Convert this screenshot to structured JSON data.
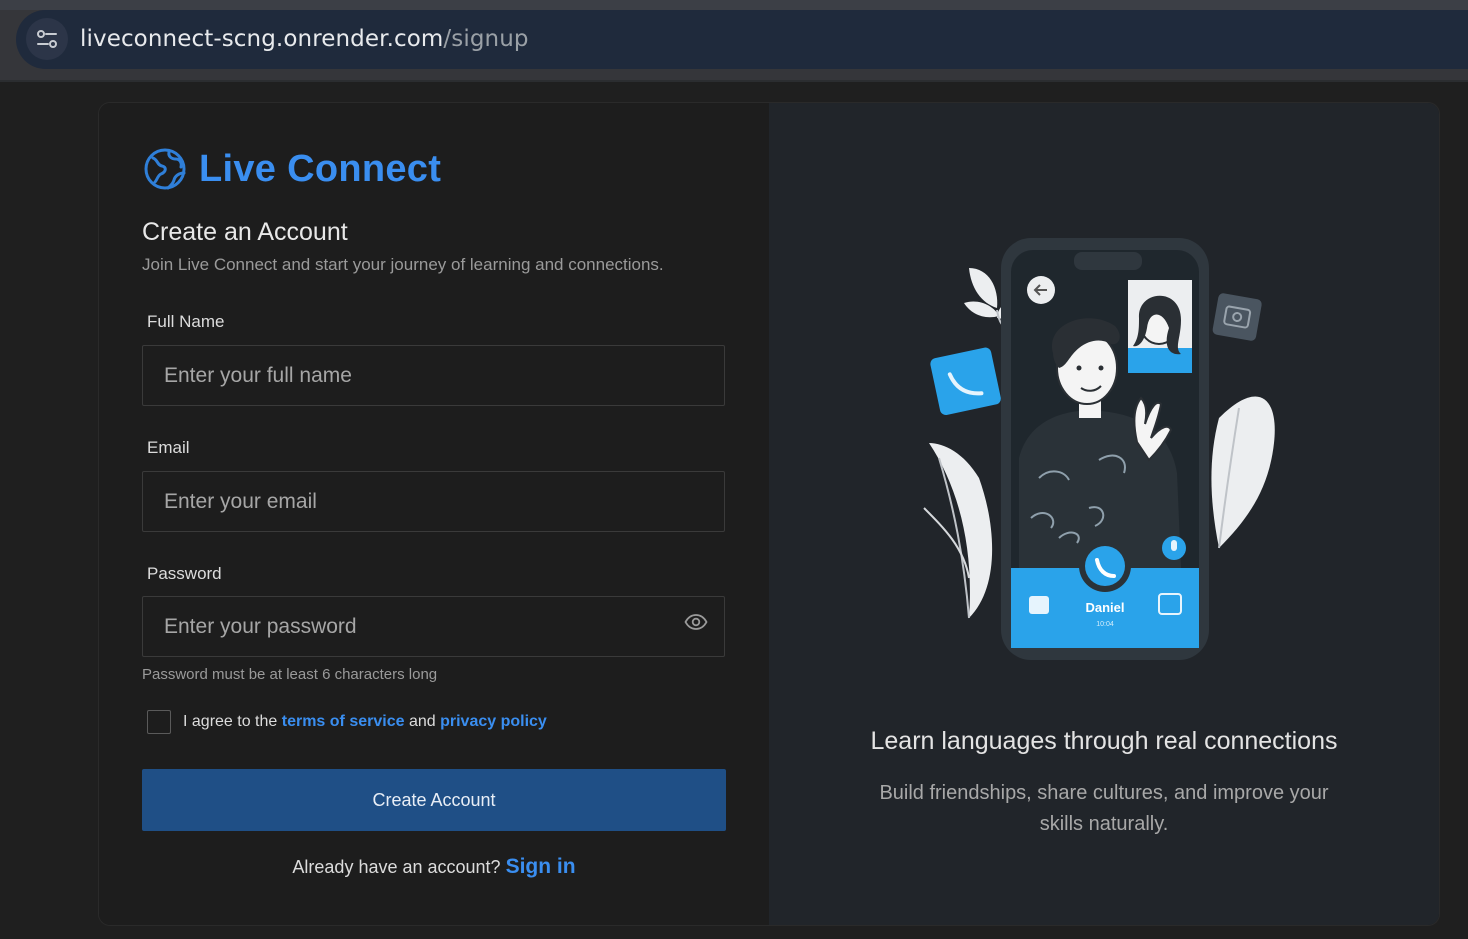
{
  "browser": {
    "url_host": "liveconnect-scng.onrender.com",
    "url_path": "/signup",
    "site_settings_icon": "tune-icon"
  },
  "brand": {
    "name": "Live Connect",
    "logo_icon": "globe-icon",
    "color": "#3a8ef0"
  },
  "form": {
    "title": "Create an Account",
    "subtitle": "Join Live Connect and start your journey of learning and connections.",
    "full_name": {
      "label": "Full Name",
      "placeholder": "Enter your full name",
      "value": ""
    },
    "email": {
      "label": "Email",
      "placeholder": "Enter your email",
      "value": ""
    },
    "password": {
      "label": "Password",
      "placeholder": "Enter your password",
      "value": "",
      "hint": "Password must be at least 6 characters long",
      "toggle_icon": "eye-icon"
    },
    "agree": {
      "checked": false,
      "prefix": "I agree to the",
      "terms_label": "terms of service",
      "and": "and",
      "privacy_label": "privacy policy"
    },
    "submit_label": "Create Account",
    "submit_color": "#1f4f86",
    "signin_prompt": "Already have an account?",
    "signin_label": "Sign in"
  },
  "promo": {
    "title": "Learn languages through real connections",
    "subtitle": "Build friendships, share cultures, and improve your skills naturally.",
    "caller_name": "Daniel",
    "call_time": "10:04"
  }
}
